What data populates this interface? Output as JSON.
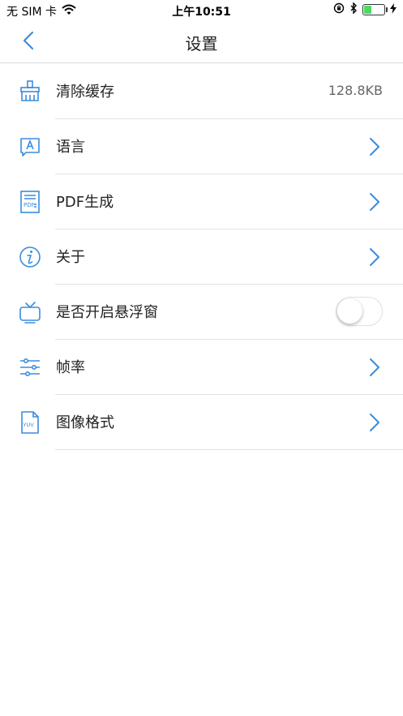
{
  "status_bar": {
    "carrier": "无 SIM 卡",
    "time": "上午10:51",
    "battery_level": 0.4
  },
  "navbar": {
    "title": "设置"
  },
  "settings": {
    "items": [
      {
        "label": "清除缓存",
        "value": "128.8KB",
        "icon": "broom-icon"
      },
      {
        "label": "语言",
        "icon": "language-icon"
      },
      {
        "label": "PDF生成",
        "icon": "pdf-icon",
        "icon_text": "PDF"
      },
      {
        "label": "关于",
        "icon": "info-icon"
      },
      {
        "label": "是否开启悬浮窗",
        "icon": "tv-icon",
        "toggle_on": false
      },
      {
        "label": "帧率",
        "icon": "sliders-icon"
      },
      {
        "label": "图像格式",
        "icon": "yuv-file-icon",
        "icon_text": "YUV"
      }
    ]
  },
  "colors": {
    "accent": "#3c8cdc"
  }
}
